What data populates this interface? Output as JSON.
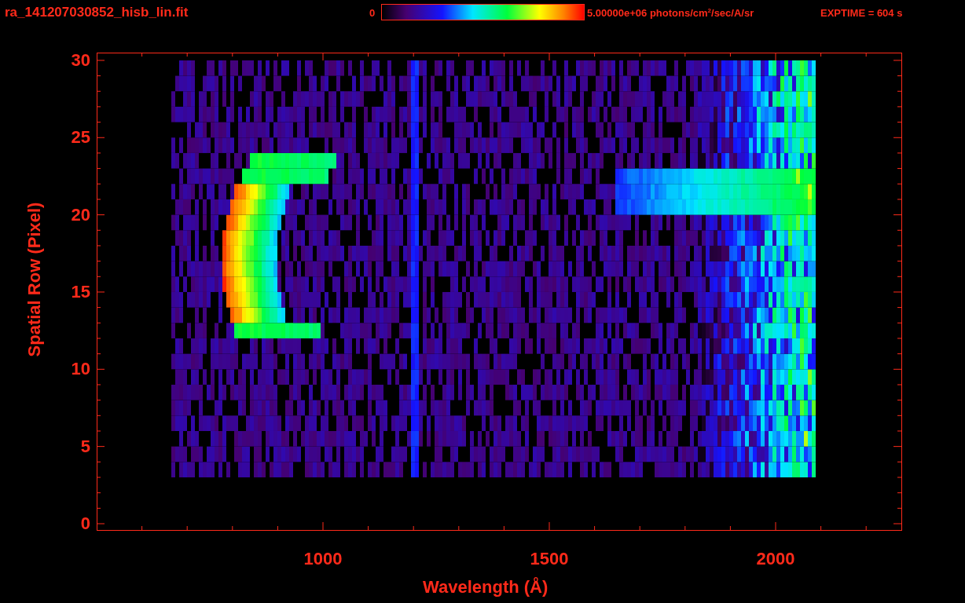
{
  "title": "ra_141207030852_hisb_lin.fit",
  "colorbar": {
    "min_label": "0",
    "max_label": "5.00000e+06 photons/cm$^{2}$/sec/A/sr"
  },
  "exposure": "EXPTIME = 604 s",
  "y_axis": {
    "label": "Spatial Row (Pixel)",
    "ticks": [
      "30",
      "25",
      "20",
      "15",
      "10",
      "5",
      "0"
    ]
  },
  "x_axis": {
    "label": "Wavelength (Å)",
    "ticks": [
      "1000",
      "1500",
      "2000"
    ]
  }
}
